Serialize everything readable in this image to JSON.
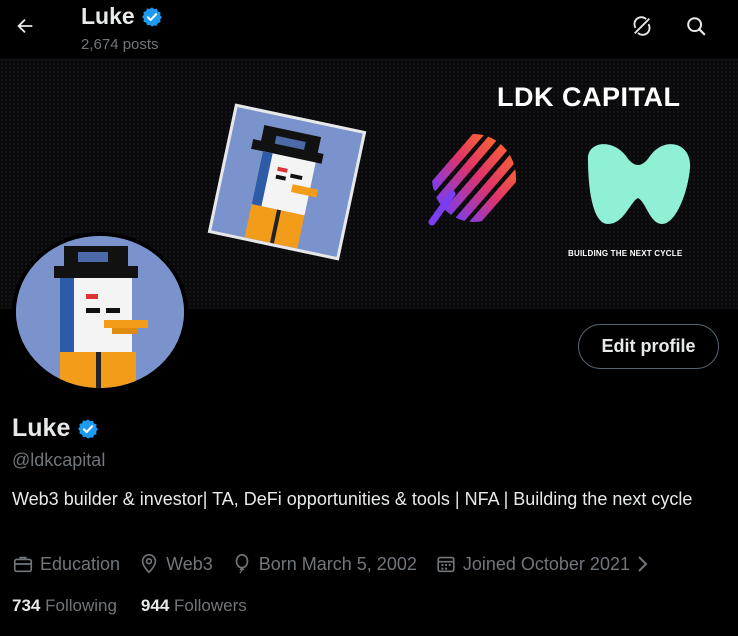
{
  "header": {
    "name": "Luke",
    "posts": "2,674 posts",
    "back_icon": "arrow-left-icon",
    "grok_icon": "grok-icon",
    "search_icon": "search-icon"
  },
  "banner": {
    "title": "LDK CAPITAL",
    "tagline": "BUILDING THE NEXT CYCLE"
  },
  "actions": {
    "edit_profile": "Edit profile"
  },
  "profile": {
    "name": "Luke",
    "handle": "@ldkcapital",
    "bio": "Web3 builder & investor| TA, DeFi opportunities & tools | NFA | Building the next cycle",
    "category": "Education",
    "location": "Web3",
    "birthday": "Born March 5, 2002",
    "joined": "Joined October 2021"
  },
  "stats": {
    "following_count": "734",
    "following_label": "Following",
    "followers_count": "944",
    "followers_label": "Followers"
  },
  "colors": {
    "verified": "#1d9bf0",
    "muted": "#71767b",
    "accent_mint": "#8ff0d6"
  }
}
